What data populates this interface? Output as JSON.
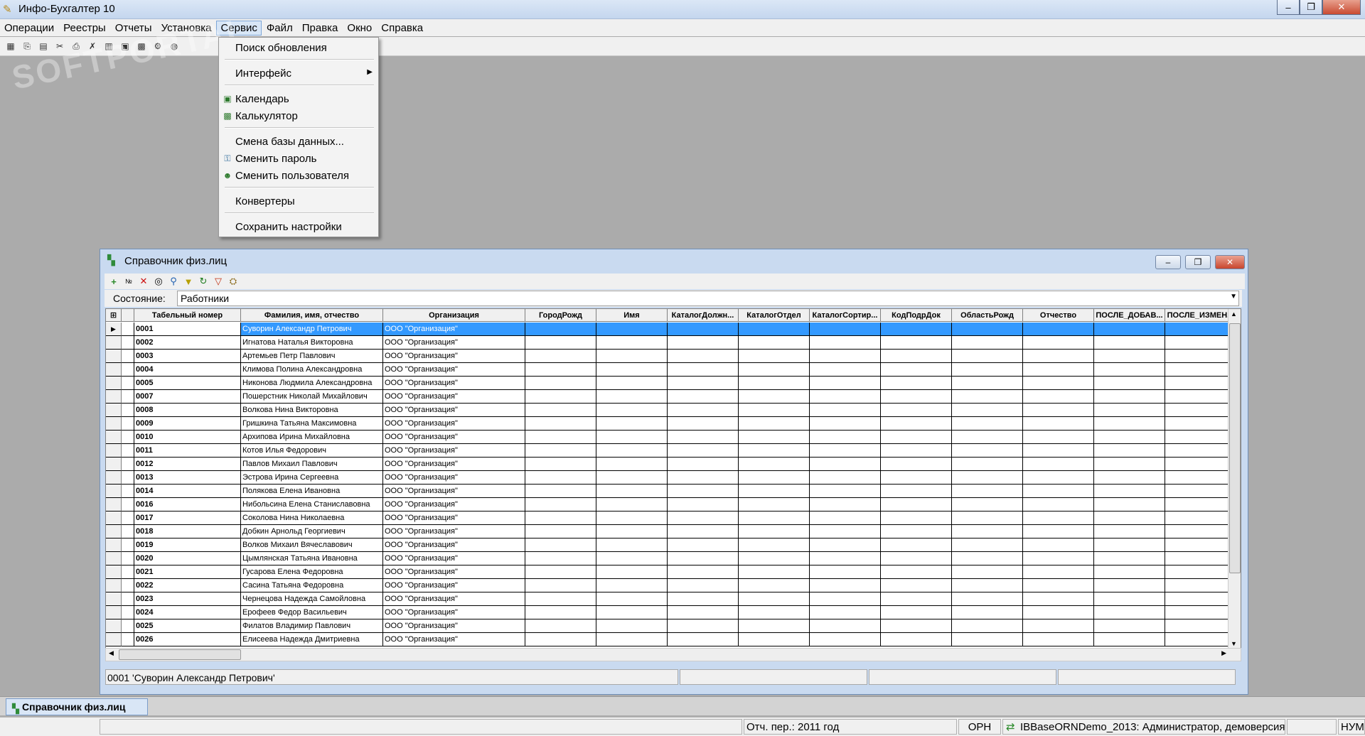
{
  "app": {
    "title": "Инфо-Бухгалтер 10"
  },
  "menu": [
    "Операции",
    "Реестры",
    "Отчеты",
    "Установка",
    "Сервис",
    "Файл",
    "Правка",
    "Окно",
    "Справка"
  ],
  "watermark": "SOFTPORTAL",
  "service_menu": {
    "search_updates": "Поиск обновления",
    "interface": "Интерфейс",
    "calendar": "Календарь",
    "calculator": "Калькулятор",
    "change_db": "Смена базы данных...",
    "change_password": "Сменить пароль",
    "change_user": "Сменить пользователя",
    "converters": "Конвертеры",
    "save_settings": "Сохранить настройки"
  },
  "child": {
    "title": "Справочник физ.лиц",
    "state_label": "Состояние:",
    "state_value": "Работники",
    "columns": [
      "Табельный номер",
      "Фамилия, имя, отчество",
      "Организация",
      "ГородРожд",
      "Имя",
      "КаталогДолжн...",
      "КаталогОтдел",
      "КаталогСортир...",
      "КодПодрДок",
      "ОбластьРожд",
      "Отчество",
      "ПОСЛЕ_ДОБАВ...",
      "ПОСЛЕ_ИЗМЕН..."
    ],
    "rows": [
      [
        "0001",
        "Суворин Александр Петрович",
        "ООО \"Организация\""
      ],
      [
        "0002",
        "Игнатова Наталья Викторовна",
        "ООО \"Организация\""
      ],
      [
        "0003",
        "Артемьев Петр Павлович",
        "ООО \"Организация\""
      ],
      [
        "0004",
        "Климова Полина Александровна",
        "ООО \"Организация\""
      ],
      [
        "0005",
        "Никонова Людмила Александровна",
        "ООО \"Организация\""
      ],
      [
        "0007",
        "Пошерстник Николай Михайлович",
        "ООО \"Организация\""
      ],
      [
        "0008",
        "Волкова Нина Викторовна",
        "ООО \"Организация\""
      ],
      [
        "0009",
        "Гришкина Татьяна Максимовна",
        "ООО \"Организация\""
      ],
      [
        "0010",
        "Архипова Ирина Михайловна",
        "ООО \"Организация\""
      ],
      [
        "0011",
        "Котов Илья Федорович",
        "ООО \"Организация\""
      ],
      [
        "0012",
        "Павлов Михаил Павлович",
        "ООО \"Организация\""
      ],
      [
        "0013",
        "Эстрова Ирина Сергеевна",
        "ООО \"Организация\""
      ],
      [
        "0014",
        "Полякова Елена Ивановна",
        "ООО \"Организация\""
      ],
      [
        "0016",
        "Нибольсина Елена Станиславовна",
        "ООО \"Организация\""
      ],
      [
        "0017",
        "Соколова Нина Николаевна",
        "ООО \"Организация\""
      ],
      [
        "0018",
        "Добкин Арнольд Георгиевич",
        "ООО \"Организация\""
      ],
      [
        "0019",
        "Волков Михаил Вячеславович",
        "ООО \"Организация\""
      ],
      [
        "0020",
        "Цымлянская Татьяна Ивановна",
        "ООО \"Организация\""
      ],
      [
        "0021",
        "Гусарова Елена Федоровна",
        "ООО \"Организация\""
      ],
      [
        "0022",
        "Сасина Татьяна Федоровна",
        "ООО \"Организация\""
      ],
      [
        "0023",
        "Чернецова Надежда Самойловна",
        "ООО \"Организация\""
      ],
      [
        "0024",
        "Ерофеев Федор Васильевич",
        "ООО \"Организация\""
      ],
      [
        "0025",
        "Филатов Владимир Павлович",
        "ООО \"Организация\""
      ],
      [
        "0026",
        "Елисеева Надежда Дмитриевна",
        "ООО \"Организация\""
      ]
    ],
    "status_text": "0001 'Суворин Александр Петрович'"
  },
  "task_tab": "Справочник физ.лиц",
  "statusbar": {
    "period": "Отч. пер.: 2011 год",
    "org": "ОРН",
    "db": "IBBaseORNDemo_2013: Администратор, демоверсия",
    "num": "НУМ"
  }
}
